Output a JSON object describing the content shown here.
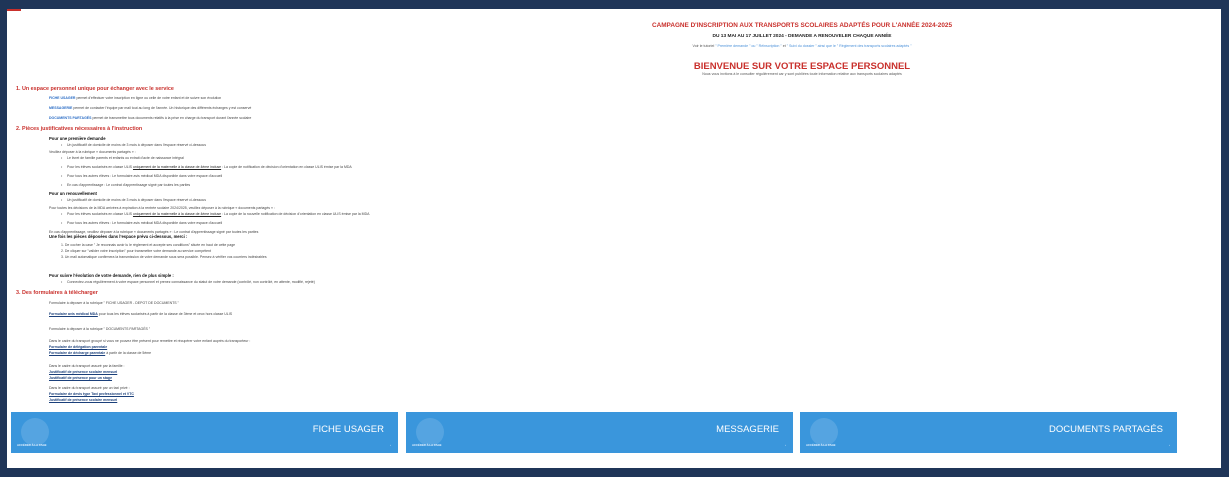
{
  "header": {
    "campaign": "CAMPAGNE D'INSCRIPTION AUX TRANSPORTS SCOLAIRES ADAPTÉS POUR L'ANNÉE 2024-2025",
    "dates": "DU 13 MAI AU 17 JUILLET 2024 - DEMANDE A RENOUVELER CHAQUE ANNÉE",
    "hint_prefix": "Voir le tutoriel",
    "hint_quote1": "\" Première demande \" ou \" Réinscription \"",
    "hint_mid": "et",
    "hint_quote2": "\" Suivi du dossier \"",
    "hint_end": "ainsi que le \" Règlement des transports scolaires adaptés \"",
    "welcome": "BIENVENUE SUR VOTRE ESPACE PERSONNEL",
    "welcome_sub": "Nous vous invitons à le consulter régulièrement car y sont publiées toute information relative aux transports scolaires adaptés"
  },
  "section1": {
    "title": "1. Un espace personnel unique pour échanger avec le service",
    "items": [
      {
        "label": "FICHE USAGER",
        "text": "permet d'effectuer votre inscription en ligne ou celle de votre enfant et de suivre son évolution"
      },
      {
        "label": "MESSAGERIE",
        "text": "permet de contacter l'équipe par mail tout au long de l'année. Un historique des différents échanges y est conservé"
      },
      {
        "label": "DOCUMENTS PARTAGÉS",
        "text": "permet de transmettre tous documents relatifs à la prise en charge du transport durant l'année scolaire"
      }
    ]
  },
  "section2": {
    "title": "2. Pièces justificatives nécessaires à l'instruction",
    "first_heading": "Pour une première demande",
    "first_bullet": "Un justificatif de domicile de moins de 3 mois à déposer dans l'espace réservé ci-dessous",
    "first_intro": "Veuillez déposer à la rubrique « documents partagés » :",
    "first_items": [
      "Le livret de famille parents et enfants ou extrait d'acte de naissance intégral",
      "Pour les élèves scolarisés en classe ULIS",
      "uniquement de la maternelle à la classe de 4ème incluse",
      " : La copie de notification de décision d'orientation en classe ULIS émise par la MDA",
      "Pour tous les autres élèves : Le formulaire avis médical MDA disponible dans votre espace d'accueil",
      "En cas d'apprentissage : Le contrat d'apprentissage signé par toutes les parties"
    ],
    "renew_heading": "Pour un renouvellement",
    "renew_bullet": "Un justificatif de domicile de moins de 3 mois à déposer dans l'espace réservé ci-dessous",
    "renew_intro": "Pour toutes les décisions de la MDA arrivées à expiration à la rentrée scolaire 2024/2025, veuillez déposer à la rubrique « documents partagés » :",
    "renew_items": [
      "Pour les élèves scolarisés en classe ULIS",
      "uniquement de la maternelle à la classe de 4ème incluse",
      " : La copie de la nouvelle notification de décision d'orientation en classe ULIS émise par la MDA",
      "Pour tous les autres élèves : Le formulaire avis médical MDA disponible dans votre espace d'accueil"
    ],
    "apprentice_line": "En cas d'apprentissage, veuillez déposer à la rubrique « documents partagés » : Le contrat d'apprentissage signé par toutes les parties",
    "after_heading": "Une fois les pièces déposées dans l'espace prévu ci-dessous, merci :",
    "steps": [
      "1. De cocher la case \" Je reconnais avoir lu le règlement et accepte ses conditions\" située en haut de cette page",
      "2. De cliquer sur \"valider votre inscription\" pour transmettre votre demande au service compétent",
      "3. Un mail automatique confirmera la transmission de votre demande sous sera possible. Pensez à vérifier vos courriers indésirables"
    ],
    "follow_heading": "Pour suivre l'évolution de votre demande, rien de plus simple :",
    "follow_item": "Connectez-vous régulièrement à votre espace personnel et prenez connaissance du statut de votre demande (contrôlé, non contrôlé, en attente, modifié, rejeté)"
  },
  "section3": {
    "title": "3. Des formulaires à télécharger",
    "group1_intro": "Formulaire à déposer à la rubrique \" FICHE USAGER - DEPOT DE DOCUMENTS \"",
    "group1_link": "Formulaire avis médical MDA",
    "group1_text": " pour tous les élèves scolarisés à partir de la classe de 3ème et ceux hors classe ULIS",
    "group2_intro": "Formulaire à déposer à la rubrique \" DOCUMENTS PARTAGÉS \"",
    "group2_text": "Dans le cadre du transport groupé si vous ne pouvez être présent pour remettre et récupérer votre enfant auprès du transporteur :",
    "group2_link1": "Formulaire de délégation parentale",
    "group2_link2": "Formulaire de décharge parentale",
    "group2_link2_suffix": " à partir de la classe de 5ème",
    "group3_intro": "Dans le cadre du transport assuré par la famille :",
    "group3_link1": "Justificatif de présence scolaire mensuel",
    "group3_link2": "Justificatif de présence pour un stage",
    "group4_intro": "Dans le cadre du transport assuré par un taxi privé :",
    "group4_link1": "Formulaire de devis type Taxi professionnel et VTC",
    "group4_link2": "Justificatif de présence scolaire mensuel"
  },
  "tiles": [
    {
      "title": "FICHE USAGER",
      "access": "ACCÉDER À LA PAGE",
      "go": "›"
    },
    {
      "title": "MESSAGERIE",
      "access": "ACCÉDER À LA PAGE",
      "go": "›"
    },
    {
      "title": "DOCUMENTS PARTAGÉS",
      "access": "ACCÉDER À LA PAGE",
      "go": "›"
    }
  ]
}
